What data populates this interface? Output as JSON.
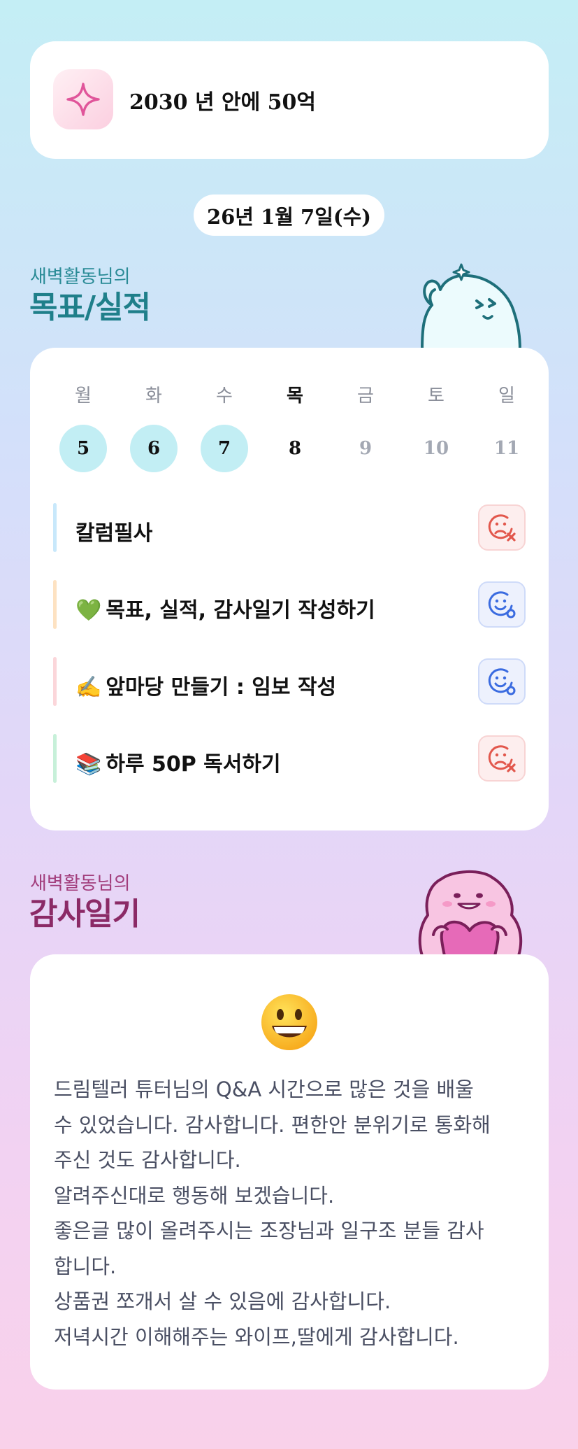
{
  "goal": {
    "icon": "sparkle-icon",
    "text": "2030 년 안에 50억"
  },
  "date_label": "26년 1월 7일(수)",
  "goals_section": {
    "subtitle": "새벽활동님의",
    "title": "목표/실적",
    "weekdays": [
      "월",
      "화",
      "수",
      "목",
      "금",
      "토",
      "일"
    ],
    "dates": [
      {
        "day": "5",
        "state": "done"
      },
      {
        "day": "6",
        "state": "done"
      },
      {
        "day": "7",
        "state": "done"
      },
      {
        "day": "8",
        "state": "today"
      },
      {
        "day": "9",
        "state": "future"
      },
      {
        "day": "10",
        "state": "future"
      },
      {
        "day": "11",
        "state": "future"
      }
    ],
    "tasks": [
      {
        "emoji": "",
        "label": "칼럼필사",
        "status": "fail",
        "status_icon": "sad-face-x-icon",
        "bar_color": "#c8e8fb"
      },
      {
        "emoji": "💚",
        "label": "목표, 실적, 감사일기 작성하기",
        "status": "ok",
        "status_icon": "smile-face-check-icon",
        "bar_color": "#fde2c2"
      },
      {
        "emoji": "✍️",
        "label": "앞마당 만들기 : 임보 작성",
        "status": "ok",
        "status_icon": "smile-face-check-icon",
        "bar_color": "#fbd6da"
      },
      {
        "emoji": "📚",
        "label": "하루 50P 독서하기",
        "status": "fail",
        "status_icon": "sad-face-x-icon",
        "bar_color": "#c7f0d9"
      }
    ]
  },
  "gratitude_section": {
    "subtitle": "새벽활동님의",
    "title": "감사일기",
    "emoji": "grinning-face-icon",
    "lines": [
      "드림텔러 튜터님의 Q&A 시간으로 많은 것을 배울",
      "수 있었습니다. 감사합니다. 편한안 분위기로 통화해",
      "주신 것도 감사합니다.",
      "알려주신대로 행동해 보겠습니다.",
      "좋은글 많이 올려주시는 조장님과 일구조 분들 감사",
      "합니다.",
      "상품권 쪼개서 살 수 있음에 감사합니다.",
      "저녁시간 이해해주는 와이프,딸에게 감사합니다."
    ]
  },
  "colors": {
    "goals_title": "#1f7f8a",
    "gratitude_title": "#8b2a66",
    "done_bg": "#c2eef4",
    "fail_icon": "#e2574c",
    "ok_icon": "#3a6be0"
  }
}
